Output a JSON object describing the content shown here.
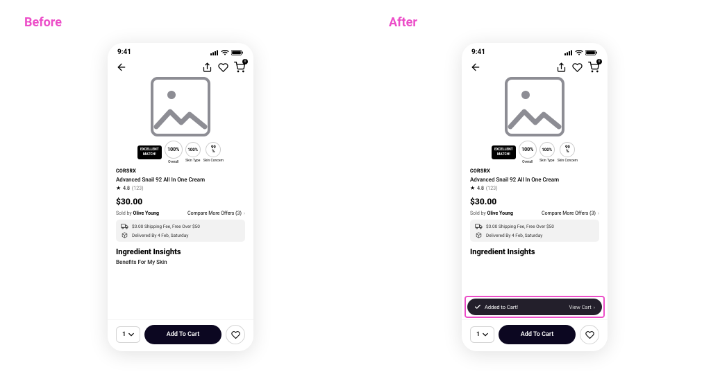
{
  "labels": {
    "before": "Before",
    "after": "After"
  },
  "statusbar": {
    "time": "9:41"
  },
  "nav": {
    "cart_badge": "0"
  },
  "match": {
    "badge_line1": "EXCELLENT",
    "badge_line2": "MATCH!",
    "overall": {
      "value": "100%",
      "label": "Overall"
    },
    "skintype": {
      "value": "100%",
      "label": "Skin Type"
    },
    "concern": {
      "value_line1": "99",
      "value_line2": "%",
      "label": "Skin Concern"
    }
  },
  "product": {
    "brand": "CORSRX",
    "name": "Advanced Snail 92 All In One Cream",
    "rating_value": "4.8",
    "rating_count": "(123)",
    "price": "$30.00",
    "sold_by_prefix": "Sold by",
    "sold_by_vendor": "Olive Young",
    "compare_label": "Compare More Offers (3)"
  },
  "shipping": {
    "line1": "$3.00 Shipping Fee, Free Over $50",
    "line2": "Delivered By 4 Feb, Saturday"
  },
  "ingredients": {
    "title": "Ingredient Insights",
    "subtitle": "Benefits For My Skin"
  },
  "snackbar": {
    "message": "Added to Cart!",
    "action": "View Cart"
  },
  "bottom": {
    "qty": "1",
    "add_to_cart": "Add To Cart"
  }
}
